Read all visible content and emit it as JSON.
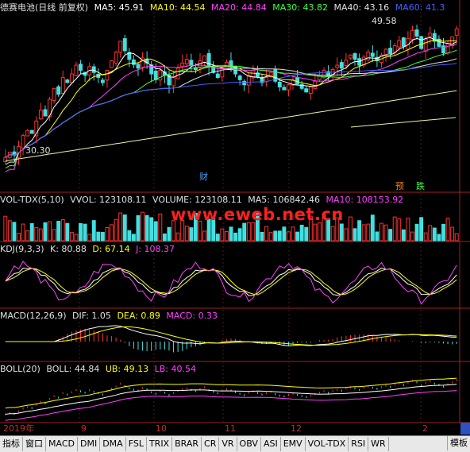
{
  "main": {
    "stock": "德赛电池(日线 前复权)",
    "ma": [
      {
        "label": "MA5: 45.91",
        "color": "#ffffff"
      },
      {
        "label": "MA10: 44.54",
        "color": "#ffff00"
      },
      {
        "label": "MA20: 44.84",
        "color": "#ff40ff"
      },
      {
        "label": "MA30: 43.82",
        "color": "#40ff40"
      },
      {
        "label": "MA40: 43.16",
        "color": "#e0e0e0"
      },
      {
        "label": "MA60: 41.3",
        "color": "#4060ff"
      }
    ],
    "high_label": "49.58",
    "low_label": "30.30",
    "event_cai": "财",
    "event_yu": "预",
    "event_die": "跌"
  },
  "volume": {
    "title": "VOL-TDX(5,10)",
    "vvol": "VVOL: 123108.11",
    "volume": "VOLUME: 123108.11",
    "ma5": "MA5: 106842.46",
    "ma10": "MA10: 108153.92"
  },
  "watermark": "www.eweb.net.cn",
  "kdj": {
    "title": "KDJ(9,3,3)",
    "k": "K: 80.88",
    "d": "D: 67.14",
    "j": "J: 108.37"
  },
  "macd": {
    "title": "MACD(12,26,9)",
    "dif": "DIF: 1.05",
    "dea": "DEA: 0.89",
    "macd": "MACD: 0.33"
  },
  "boll": {
    "title": "BOLL(20)",
    "boll": "BOLL: 44.84",
    "ub": "UB: 49.13",
    "lb": "LB: 40.54"
  },
  "date_axis": [
    "2019年",
    "9",
    "10",
    "11",
    "12",
    "2"
  ],
  "tabs": [
    "指标",
    "窗口",
    "MACD",
    "DMI",
    "DMA",
    "FSL",
    "TRIX",
    "BRAR",
    "CR",
    "VR",
    "OBV",
    "ASI",
    "EMV",
    "VOL-TDX",
    "RSI",
    "WR"
  ],
  "tab_right": "模板",
  "chart_data": {
    "type": "line",
    "title": "德赛电池(日线 前复权)",
    "candles_close": [
      31.5,
      32.2,
      31.8,
      33.0,
      34.5,
      35.2,
      34.8,
      36.5,
      38.0,
      37.2,
      39.5,
      41.0,
      40.2,
      42.5,
      41.8,
      43.0,
      44.2,
      43.5,
      42.8,
      44.0,
      43.2,
      42.5,
      41.8,
      43.5,
      44.8,
      46.0,
      47.5,
      46.2,
      45.0,
      44.3,
      43.8,
      45.2,
      44.5,
      43.0,
      42.2,
      43.5,
      42.8,
      41.5,
      42.6,
      43.8,
      44.5,
      45.0,
      44.2,
      43.6,
      44.8,
      45.5,
      44.0,
      43.2,
      42.5,
      43.8,
      44.6,
      43.9,
      43.0,
      42.2,
      41.5,
      42.8,
      43.5,
      42.6,
      41.8,
      42.5,
      43.2,
      42.0,
      41.2,
      40.8,
      41.5,
      42.2,
      41.6,
      41.0,
      40.5,
      41.2,
      42.0,
      42.8,
      43.5,
      42.7,
      43.6,
      44.2,
      43.8,
      44.9,
      45.6,
      45.0,
      44.2,
      45.3,
      46.0,
      45.4,
      44.8,
      45.6,
      46.4,
      45.8,
      46.9,
      47.6,
      46.8,
      47.9,
      49.0,
      48.2,
      46.5,
      47.8,
      48.6,
      47.5,
      46.8,
      45.9,
      47.2,
      48.1,
      49.2
    ],
    "high_label": 49.58,
    "low_label": 30.3,
    "ma": {
      "MA5": 45.91,
      "MA10": 44.54,
      "MA20": 44.84,
      "MA30": 43.82,
      "MA40": 43.16,
      "MA60": 41.3
    },
    "volume": {
      "VVOL": 123108.11,
      "VOLUME": 123108.11,
      "MA5": 106842.46,
      "MA10": 108153.92
    },
    "kdj": {
      "K": 80.88,
      "D": 67.14,
      "J": 108.37
    },
    "macd": {
      "DIF": 1.05,
      "DEA": 0.89,
      "MACD": 0.33
    },
    "boll": {
      "BOLL": 44.84,
      "UB": 49.13,
      "LB": 40.54
    }
  }
}
